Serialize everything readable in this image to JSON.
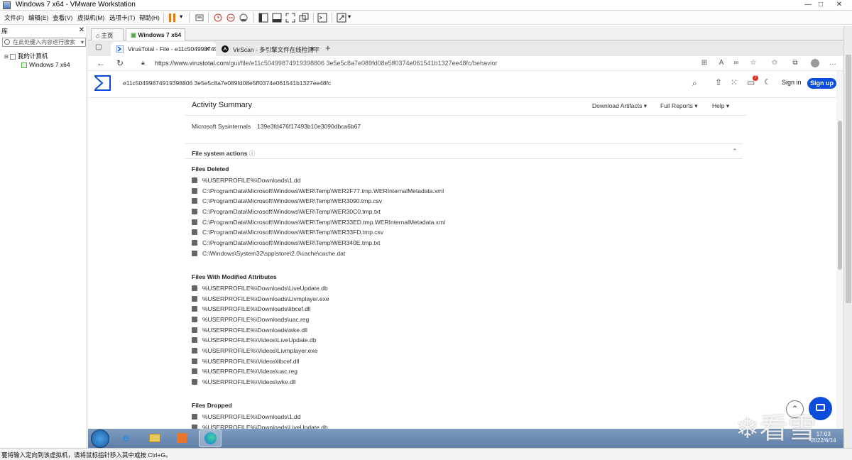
{
  "vm": {
    "title": "Windows 7 x64 - VMware Workstation",
    "menu": [
      "文件(F)",
      "编辑(E)",
      "查看(V)",
      "虚拟机(M)",
      "选项卡(T)",
      "帮助(H)"
    ],
    "library_label": "库",
    "library_search_placeholder": "在此处键入内容进行搜索",
    "tree": {
      "root": "我的计算机",
      "child": "Windows 7 x64"
    },
    "tabs": [
      {
        "label": "主页"
      },
      {
        "label": "Windows 7 x64"
      }
    ],
    "status_text": "要将输入定向到该虚拟机，请将鼠标指针移入其中或按 Ctrl+G。",
    "accent_pause": "#e07b1a"
  },
  "browser": {
    "tabs": [
      {
        "label": "VirusTotal - File - e11c5049987491"
      },
      {
        "label": "VirScan - 多引擎文件在线检测平"
      }
    ],
    "new_tab": "+",
    "url_prefix": "https://www.virustotal.com",
    "url_path": "/gui/file/e11c50499874919398806 3e5e5c8a7e089fd08e5ff0374e061541b1327ee48fc/behavior"
  },
  "vt": {
    "search_value": "e11c50499874919398806 3e5e5c8a7e089fd08e5ff0374e061541b1327ee48fc",
    "sign_in": "Sign in",
    "sign_up": "Sign up",
    "notif_count": "7",
    "brand_color": "#0b4dda",
    "activity_title": "Activity Summary",
    "links": [
      "Download Artifacts",
      "Full Reports",
      "Help"
    ],
    "sysinternals_label": "Microsoft Sysinternals",
    "sysinternals_hash": "139e3fd476f17493b10e3090dbca6b67",
    "fsa_title": "File system actions",
    "sections": [
      {
        "title": "Files Deleted",
        "items": [
          "%USERPROFILE%\\Downloads\\1.dd",
          "C:\\ProgramData\\Microsoft\\Windows\\WER\\Temp\\WER2F77.tmp.WERInternalMetadata.xml",
          "C:\\ProgramData\\Microsoft\\Windows\\WER\\Temp\\WER3090.tmp.csv",
          "C:\\ProgramData\\Microsoft\\Windows\\WER\\Temp\\WER30C0.tmp.txt",
          "C:\\ProgramData\\Microsoft\\Windows\\WER\\Temp\\WER33ED.tmp.WERInternalMetadata.xml",
          "C:\\ProgramData\\Microsoft\\Windows\\WER\\Temp\\WER33FD.tmp.csv",
          "C:\\ProgramData\\Microsoft\\Windows\\WER\\Temp\\WER340E.tmp.txt",
          "C:\\Windows\\System32\\spp\\store\\2.0\\cache\\cache.dat"
        ]
      },
      {
        "title": "Files With Modified Attributes",
        "items": [
          "%USERPROFILE%\\Downloads\\LiveUpdate.db",
          "%USERPROFILE%\\Downloads\\Livmplayer.exe",
          "%USERPROFILE%\\Downloads\\libcef.dll",
          "%USERPROFILE%\\Downloads\\uac.reg",
          "%USERPROFILE%\\Downloads\\wke.dll",
          "%USERPROFILE%\\Videos\\LiveUpdate.db",
          "%USERPROFILE%\\Videos\\Livmplayer.exe",
          "%USERPROFILE%\\Videos\\libcef.dll",
          "%USERPROFILE%\\Videos\\uac.reg",
          "%USERPROFILE%\\Videos\\wke.dll"
        ]
      },
      {
        "title": "Files Dropped",
        "items": [
          "%USERPROFILE%\\Downloads\\1.dd",
          "%USERPROFILE%\\Downloads\\LiveUpdate.db"
        ]
      }
    ]
  },
  "taskbar": {
    "time": "17:03",
    "date": "2022/6/14"
  },
  "watermark": "看雪"
}
